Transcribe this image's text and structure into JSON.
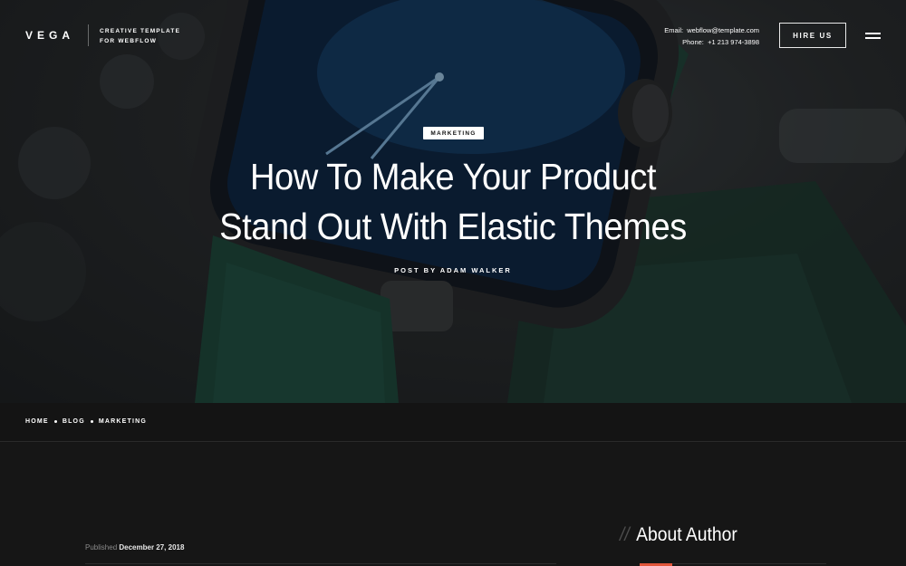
{
  "brand": {
    "logo": "VEGA",
    "tagline_line1": "CREATIVE TEMPLATE",
    "tagline_line2": "FOR WEBFLOW"
  },
  "contact": {
    "email_label": "Email:",
    "email": "webflow@template.com",
    "phone_label": "Phone:",
    "phone": "+1 213 974-3898"
  },
  "nav": {
    "hire_label": "HIRE US",
    "menu_icon": "hamburger-menu-icon"
  },
  "hero": {
    "category": "MARKETING",
    "title_line1": "How To Make Your Product",
    "title_line2": "Stand Out With Elastic Themes",
    "byline": "POST BY ADAM WALKER",
    "image_subject": "smartwatch with green leather strap"
  },
  "breadcrumb": {
    "items": [
      "HOME",
      "BLOG",
      "MARKETING"
    ]
  },
  "post": {
    "published_label": "Published",
    "published_date": "December 27, 2018"
  },
  "sidebar": {
    "heading_prefix": "//",
    "heading": "About Author"
  },
  "colors": {
    "background": "#151515",
    "accent": "#e0553a",
    "strap_green": "#1f4a3d"
  }
}
